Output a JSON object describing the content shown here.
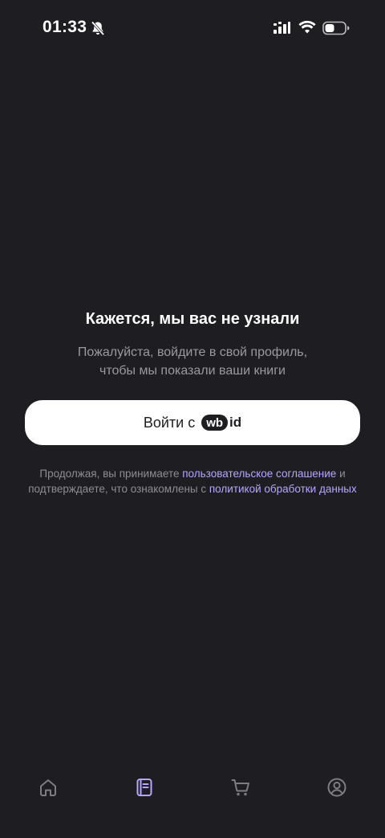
{
  "status_bar": {
    "time": "01:33",
    "icons": [
      "bell-muted-icon",
      "signal-icon",
      "wifi-icon",
      "battery-icon"
    ]
  },
  "main": {
    "headline": "Кажется, мы вас не узнали",
    "subtitle_line1": "Пожалуйста, войдите в свой профиль,",
    "subtitle_line2": "чтобы мы показали ваши книги",
    "login_button": {
      "label": "Войти с",
      "logo_wb": "wb",
      "logo_id": "id"
    },
    "legal": {
      "prefix": "Продолжая, вы принимаете ",
      "link_agreement": "пользовательское соглашение",
      "middle": " и подтверждаете, что ознакомлены с ",
      "link_policy": "политикой обработки данных"
    }
  },
  "bottom_nav": {
    "items": [
      {
        "icon": "home-icon",
        "active": false
      },
      {
        "icon": "book-icon",
        "active": true
      },
      {
        "icon": "cart-icon",
        "active": false
      },
      {
        "icon": "profile-icon",
        "active": false
      }
    ]
  },
  "colors": {
    "background": "#1e1d21",
    "accent": "#b8a6ff",
    "nav_inactive": "#7d7c84",
    "nav_active": "#b8a6ff"
  }
}
